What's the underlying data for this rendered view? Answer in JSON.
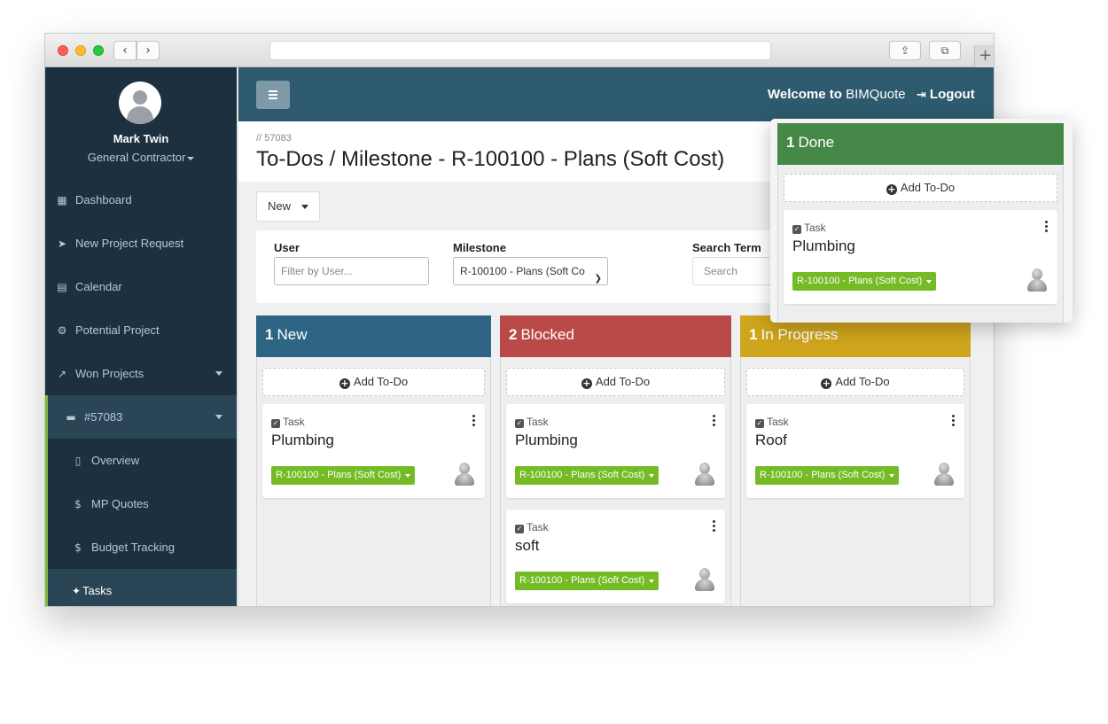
{
  "colors": {
    "sidebar_bg": "#1c3040",
    "header_bg": "#2d5a6e",
    "new": "#2f6584",
    "blocked": "#b94a48",
    "in_progress": "#cfa51d",
    "done": "#468847",
    "badge": "#74bb25",
    "accent": "#7cba3b"
  },
  "browser": {
    "back_icon": "‹",
    "forward_icon": "›",
    "share_icon": "⇪",
    "tabs_icon": "⧉",
    "new_tab_icon": "+"
  },
  "sidebar": {
    "user_name": "Mark Twin",
    "user_role": "General Contractor",
    "items": [
      {
        "label": "Dashboard",
        "icon": "dashboard-icon",
        "glyph": "▦"
      },
      {
        "label": "New Project Request",
        "icon": "paper-plane-icon",
        "glyph": "➤"
      },
      {
        "label": "Calendar",
        "icon": "calendar-icon",
        "glyph": "▤"
      },
      {
        "label": "Potential Project",
        "icon": "gears-icon",
        "glyph": "⚙"
      },
      {
        "label": "Won Projects",
        "icon": "chart-line-icon",
        "glyph": "↗"
      },
      {
        "label": "#57083",
        "icon": "briefcase-icon",
        "glyph": "▬"
      },
      {
        "label": "Overview",
        "icon": "file-icon",
        "glyph": "▯"
      },
      {
        "label": "MP Quotes",
        "icon": "dollar-icon",
        "glyph": "$"
      },
      {
        "label": "Budget Tracking",
        "icon": "dollar-icon",
        "glyph": "$"
      },
      {
        "label": "Tasks",
        "icon": "pin-icon",
        "glyph": "✦"
      }
    ]
  },
  "header": {
    "welcome_prefix": "Welcome to",
    "app_name": "BIMQuote",
    "logout_icon": "⇥",
    "logout_label": "Logout"
  },
  "page": {
    "breadcrumb": "// 57083",
    "title": "To-Dos / Milestone - R-100100 - Plans (Soft Cost)",
    "new_button": "New"
  },
  "filters": {
    "user_label": "User",
    "user_placeholder": "Filter by User...",
    "milestone_label": "Milestone",
    "milestone_value": "R-100100 - Plans (Soft Co",
    "search_label": "Search Term",
    "search_placeholder": "Search"
  },
  "board": {
    "add_label": "Add To-Do",
    "type_label": "Task",
    "badge_label": "R-100100 - Plans (Soft Cost)",
    "columns": [
      {
        "count": "1",
        "name": "New",
        "cards": [
          "Plumbing"
        ]
      },
      {
        "count": "2",
        "name": "Blocked",
        "cards": [
          "Plumbing",
          "soft"
        ]
      },
      {
        "count": "1",
        "name": "In Progress",
        "cards": [
          "Roof"
        ]
      },
      {
        "count": "1",
        "name": "Done",
        "cards": [
          "Plumbing"
        ]
      }
    ]
  }
}
